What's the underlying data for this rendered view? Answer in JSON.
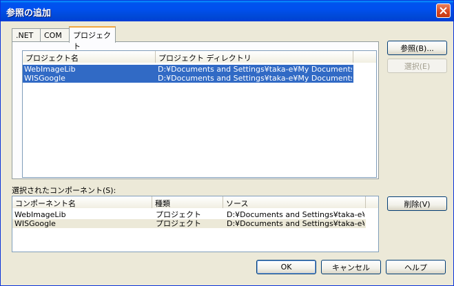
{
  "window": {
    "title": "参照の追加"
  },
  "tabs": [
    {
      "label": ".NET",
      "active": false
    },
    {
      "label": "COM",
      "active": false
    },
    {
      "label": "プロジェクト",
      "active": true
    }
  ],
  "projects_list": {
    "columns": [
      "プロジェクト名",
      "プロジェクト ディレクトリ"
    ],
    "rows": [
      {
        "name": "WebImageLib",
        "dir": "D:¥Documents and Settings¥taka-e¥My Documents¥...",
        "selected": true
      },
      {
        "name": "WISGoogle",
        "dir": "D:¥Documents and Settings¥taka-e¥My Documents¥...",
        "selected": true
      }
    ]
  },
  "side_buttons": {
    "browse": "参照(B)...",
    "select": "選択(E)",
    "remove": "削除(V)"
  },
  "selected_components": {
    "label": "選択されたコンポーネント(S):",
    "columns": [
      "コンポーネント名",
      "種類",
      "ソース"
    ],
    "rows": [
      {
        "name": "WebImageLib",
        "type": "プロジェクト",
        "source": "D:¥Documents and Settings¥taka-e¥..."
      },
      {
        "name": "WISGoogle",
        "type": "プロジェクト",
        "source": "D:¥Documents and Settings¥taka-e¥..."
      }
    ]
  },
  "footer": {
    "ok": "OK",
    "cancel": "キャンセル",
    "help": "ヘルプ"
  },
  "icons": {
    "close": "close-icon"
  },
  "colors": {
    "titlebar": "#0053ee",
    "selection": "#316ac5",
    "dialog_bg": "#ece9d8"
  }
}
